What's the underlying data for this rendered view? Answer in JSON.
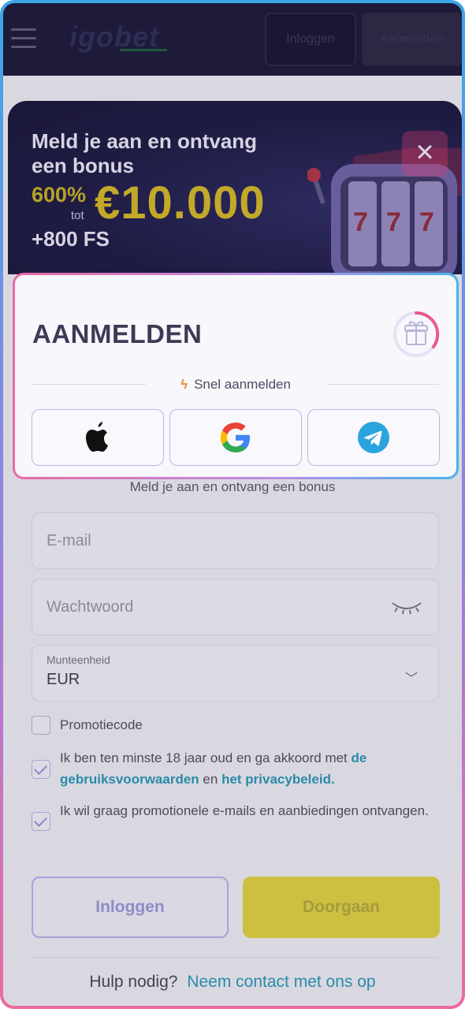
{
  "header": {
    "logo_text": "igobet",
    "login_label": "Inloggen",
    "signup_label": "Aanmelden"
  },
  "banner": {
    "title": "Meld je aan en ontvang een bonus",
    "percent": "600%",
    "tot": "tot",
    "amount": "€10.000",
    "free_spins": "+800 FS",
    "close_icon": "close-icon"
  },
  "modal": {
    "title": "AANMELDEN",
    "quick_signup": "Snel aanmelden",
    "social": [
      {
        "name": "apple",
        "icon": "apple-icon"
      },
      {
        "name": "google",
        "icon": "google-icon"
      },
      {
        "name": "telegram",
        "icon": "telegram-icon"
      }
    ]
  },
  "form": {
    "subtitle": "Meld je aan en ontvang een bonus",
    "email_placeholder": "E-mail",
    "password_placeholder": "Wachtwoord",
    "currency_label": "Munteenheid",
    "currency_value": "EUR",
    "promo_label": "Promotiecode",
    "terms_prefix": "Ik ben ten minste 18 jaar oud en ga akkoord met",
    "terms_link1": "de gebruiksvoorwaarden",
    "terms_and": "en",
    "terms_link2": "het privacybeleid.",
    "marketing_label": "Ik wil graag promotionele e-mails en aanbiedingen ontvangen.",
    "login_button": "Inloggen",
    "continue_button": "Doorgaan",
    "help_text": "Hulp nodig?",
    "help_link": "Neem contact met ons op"
  },
  "colors": {
    "accent_yellow": "#cdbf3f",
    "link": "#2a8aa9",
    "header_bg": "#1d1a3a"
  }
}
